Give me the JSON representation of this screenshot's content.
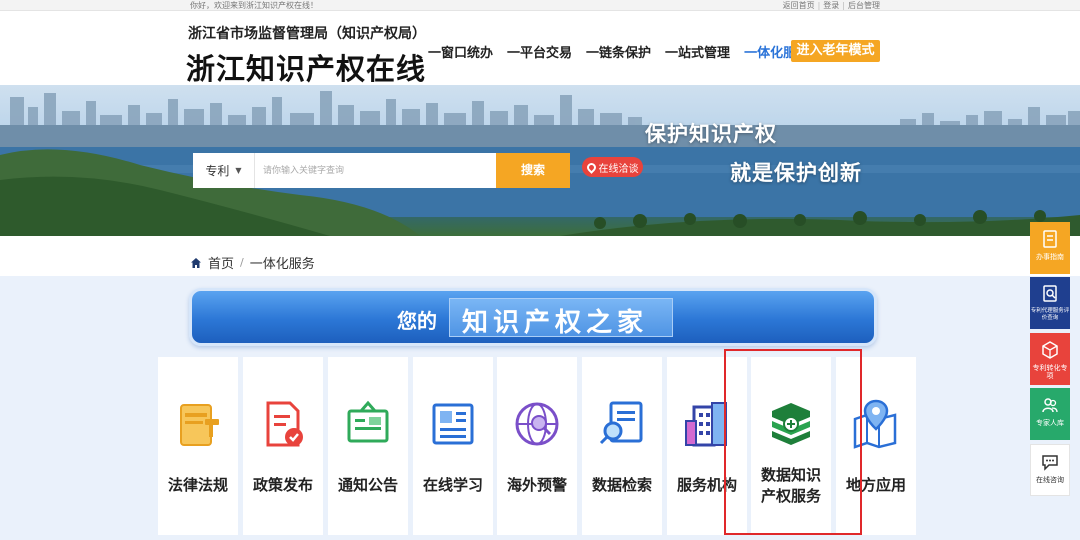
{
  "topbar": {
    "greeting": "你好，欢迎来到浙江知识产权在线！",
    "links": [
      "返回首页",
      "登录",
      "后台管理"
    ]
  },
  "header": {
    "org": "浙江省市场监督管理局（知识产权局）",
    "brand": "浙江知识产权在线",
    "nav": [
      {
        "label": "一窗口统办",
        "active": false
      },
      {
        "label": "一平台交易",
        "active": false
      },
      {
        "label": "一链条保护",
        "active": false
      },
      {
        "label": "一站式管理",
        "active": false
      },
      {
        "label": "一体化服务",
        "active": true
      }
    ],
    "elder_mode": "进入老年模式"
  },
  "banner": {
    "slogan_1": "保护知识产权",
    "slogan_2": "就是保护创新"
  },
  "search": {
    "category": "专利",
    "placeholder": "请你输入关键字查询",
    "button": "搜索",
    "consult": "在线洽谈"
  },
  "breadcrumb": {
    "home": "首页",
    "current": "一体化服务"
  },
  "section": {
    "prefix": "您的",
    "title": "知识产权之家"
  },
  "services": [
    {
      "label": "法律法规",
      "icon": "law-book-icon"
    },
    {
      "label": "政策发布",
      "icon": "policy-document-icon"
    },
    {
      "label": "通知公告",
      "icon": "notice-board-icon"
    },
    {
      "label": "在线学习",
      "icon": "online-learning-icon"
    },
    {
      "label": "海外预警",
      "icon": "globe-search-icon"
    },
    {
      "label": "数据检索",
      "icon": "data-search-icon"
    },
    {
      "label": "服务机构",
      "icon": "building-icon"
    },
    {
      "label": "数据知识产权服务",
      "icon": "data-stack-icon"
    },
    {
      "label": "地方应用",
      "icon": "map-pin-icon"
    }
  ],
  "side_tools": [
    {
      "label": "办事指南",
      "color": "#f5a623",
      "icon": "guide-icon"
    },
    {
      "label": "专利代理服务评价查询",
      "color": "#1f3f8f",
      "icon": "agent-query-icon"
    },
    {
      "label": "专利转化专项",
      "color": "#e8433c",
      "icon": "transfer-icon"
    },
    {
      "label": "专家人库",
      "color": "#27a96b",
      "icon": "expert-icon"
    },
    {
      "label": "在线咨询",
      "color": "#ffffff",
      "icon": "chat-icon"
    }
  ],
  "colors": {
    "accent": "#f5a623",
    "nav_active": "#2a73d8",
    "highlight": "#e0282a"
  }
}
